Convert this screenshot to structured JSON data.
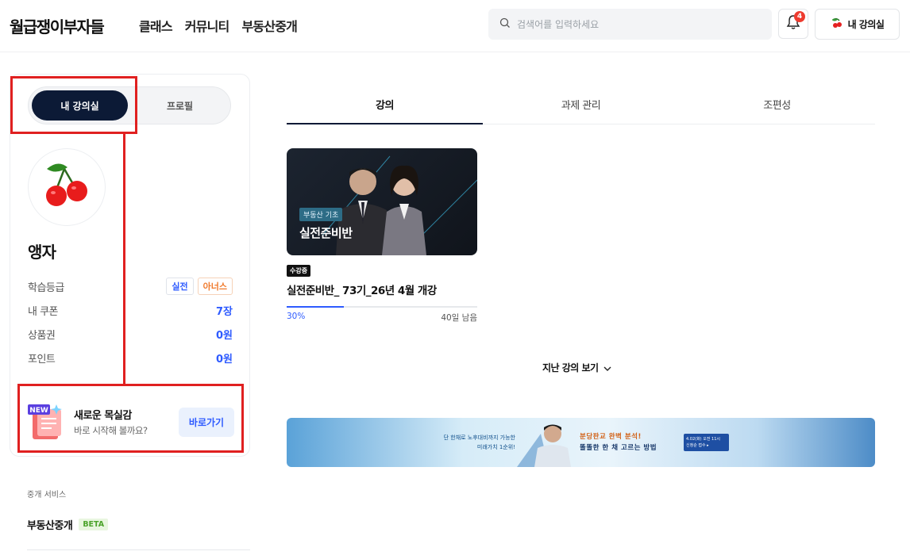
{
  "header": {
    "logo": "월급쟁이부자들",
    "nav": [
      "클래스",
      "커뮤니티",
      "부동산중개"
    ],
    "search_placeholder": "검색어를 입력하세요",
    "notification_count": "4",
    "myclass_label": "내 강의실"
  },
  "sidebar": {
    "seg_active": "내 강의실",
    "seg_inactive": "프로필",
    "username": "앵자",
    "grade_label": "학습등급",
    "grade_badges": [
      "실전",
      "아너스"
    ],
    "coupon_label": "내 쿠폰",
    "coupon_value": "7장",
    "voucher_label": "상품권",
    "voucher_value": "0원",
    "point_label": "포인트",
    "point_value": "0원",
    "promo_badge": "NEW",
    "promo_title": "새로운 목실감",
    "promo_sub": "바로 시작해 볼까요?",
    "promo_button": "바로가기",
    "service_title": "중개 서비스",
    "service_item": "부동산중개",
    "service_badge": "BETA"
  },
  "tabs": [
    "강의",
    "과제 관리",
    "조편성"
  ],
  "course": {
    "thumb_tag": "부동산 기초",
    "thumb_title": "실전준비반",
    "status": "수강중",
    "title": "실전준비반_ 73기_26년 4월 개강",
    "progress_percent": "30%",
    "progress_fraction": 0.3,
    "days_left": "40일 남음"
  },
  "past_courses": "지난 강의 보기",
  "banner": {
    "left_line1": "단 한채로 노후대비까지 가능한",
    "left_line2": "미래가치 1순위!",
    "right_line1": "분당판교 완벽 분석!",
    "right_line2": "똘똘한 한 채 고르는 방법",
    "cta_line1": "4.02(화) 오전 11시",
    "cta_line2": "신청순 접수 ▸"
  },
  "colors": {
    "brand_navy": "#0c1a36",
    "accent_blue": "#2e5bff",
    "highlight_red": "#e02020"
  }
}
